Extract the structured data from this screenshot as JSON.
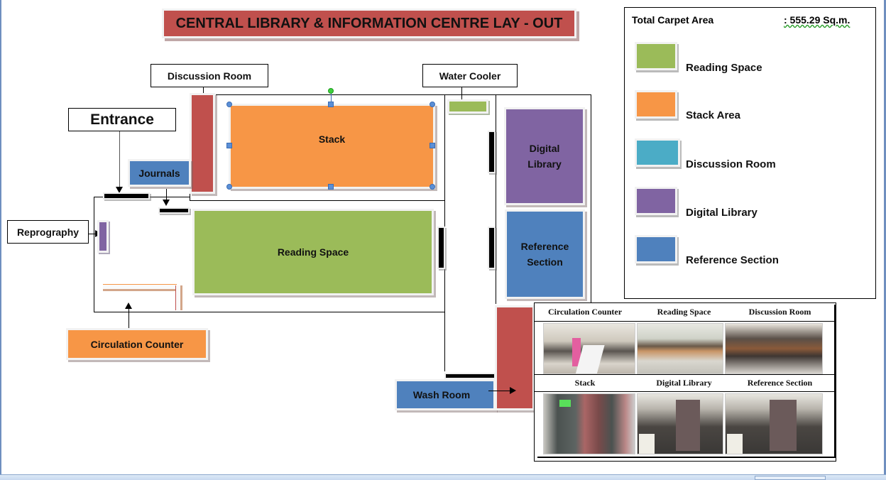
{
  "title": "CENTRAL LIBRARY & INFORMATION CENTRE LAY - OUT",
  "colors": {
    "title_bg": "#c0504d",
    "reading": "#9bbb59",
    "stack": "#f79646",
    "discussion_legend": "#4bacc6",
    "discussion_room": "#c0504d",
    "digital": "#8064a2",
    "reference": "#4f81bd"
  },
  "legend": {
    "total_label": "Total Carpet Area",
    "total_value": ": 555.29 Sq.m.",
    "items": [
      {
        "label": "Reading Space",
        "color": "#9bbb59"
      },
      {
        "label": "Stack Area",
        "color": "#f79646"
      },
      {
        "label": "Discussion Room",
        "color": "#4bacc6"
      },
      {
        "label": "Digital Library",
        "color": "#8064a2"
      },
      {
        "label": "Reference Section",
        "color": "#4f81bd"
      }
    ]
  },
  "callouts": {
    "discussion_room": "Discussion Room",
    "water_cooler": "Water Cooler",
    "entrance": "Entrance",
    "reprography": "Reprography",
    "circulation_counter": "Circulation Counter",
    "journals": "Journals",
    "wash_room": "Wash Room"
  },
  "rooms": {
    "stack": "Stack",
    "reading_space": "Reading Space",
    "digital_library_1": "Digital",
    "digital_library_2": "Library",
    "reference_1": "Reference",
    "reference_2": "Section"
  },
  "photos": {
    "row1": [
      "Circulation Counter",
      "Reading Space",
      "Discussion Room"
    ],
    "row2": [
      "Stack",
      "Digital Library",
      "Reference Section"
    ]
  }
}
